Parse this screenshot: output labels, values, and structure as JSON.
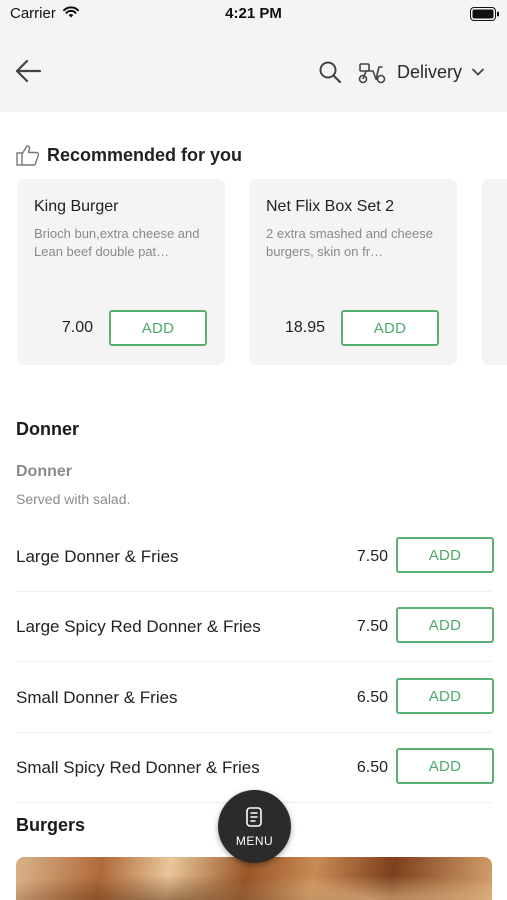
{
  "status_bar": {
    "carrier": "Carrier",
    "time": "4:21 PM"
  },
  "header": {
    "delivery_label": "Delivery"
  },
  "recommended": {
    "title": "Recommended for you",
    "items": [
      {
        "name": "King Burger",
        "description": "Brioch bun,extra cheese and Lean beef double pat…",
        "price": "7.00",
        "add_label": "ADD"
      },
      {
        "name": "Net Flix Box Set 2",
        "description": "2 extra smashed and cheese burgers, skin on fr…",
        "price": "18.95",
        "add_label": "ADD"
      }
    ]
  },
  "sections": [
    {
      "title": "Donner",
      "subtitle": "Donner",
      "subtitle_description": "Served with salad.",
      "items": [
        {
          "name": "Large Donner & Fries",
          "price": "7.50",
          "add_label": "ADD"
        },
        {
          "name": "Large Spicy Red Donner & Fries",
          "price": "7.50",
          "add_label": "ADD"
        },
        {
          "name": "Small Donner & Fries",
          "price": "6.50",
          "add_label": "ADD"
        },
        {
          "name": "Small Spicy Red Donner & Fries",
          "price": "6.50",
          "add_label": "ADD"
        }
      ]
    },
    {
      "title": "Burgers"
    }
  ],
  "menu_button": {
    "label": "MENU"
  },
  "colors": {
    "accent_green": "#5aaf73",
    "header_bg": "#f4f4f4",
    "card_bg": "#f4f4f4",
    "fab_bg": "#2b2b2b"
  },
  "icons": [
    "wifi-icon",
    "battery-icon",
    "back-arrow-icon",
    "search-icon",
    "scooter-icon",
    "chevron-down-icon",
    "thumbs-up-icon",
    "menu-icon"
  ]
}
